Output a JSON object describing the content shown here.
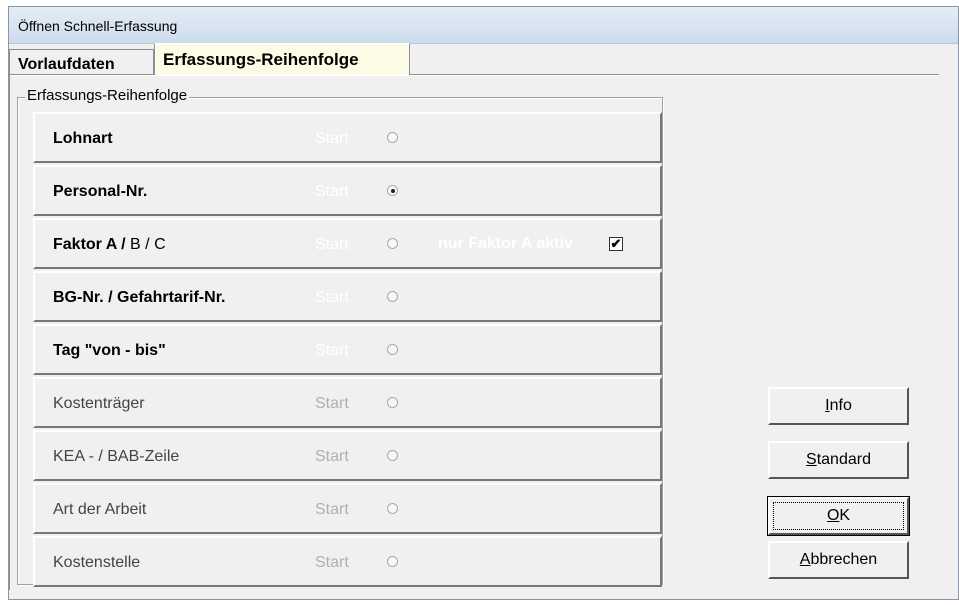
{
  "window": {
    "title": "Öffnen Schnell-Erfassung"
  },
  "tabs": [
    {
      "label": "Vorlaufdaten"
    },
    {
      "label": "Erfassungs-Reihenfolge"
    }
  ],
  "group": {
    "legend": "Erfassungs-Reihenfolge"
  },
  "rows": [
    {
      "label": "Lohnart",
      "start": "Start",
      "selected": false
    },
    {
      "label": "Personal-Nr.",
      "start": "Start",
      "selected": true
    },
    {
      "label_bold": "Faktor A /",
      "label_thin": " B / C",
      "start": "Start",
      "selected": false,
      "extra": "nur Faktor A aktiv",
      "extra_checked": true,
      "check_mark": "✔"
    },
    {
      "label": "BG-Nr. / Gefahrtarif-Nr.",
      "start": "Start",
      "selected": false
    },
    {
      "label": "Tag  \"von - bis\"",
      "start": "Start",
      "selected": false
    },
    {
      "label": "Kostenträger",
      "start": "Start",
      "selected": false
    },
    {
      "label": "KEA - / BAB-Zeile",
      "start": "Start",
      "selected": false
    },
    {
      "label": "Art der Arbeit",
      "start": "Start",
      "selected": false
    },
    {
      "label": "Kostenstelle",
      "start": "Start",
      "selected": false
    }
  ],
  "buttons": {
    "info": {
      "mnemonic": "I",
      "rest": "nfo"
    },
    "standard": {
      "mnemonic": "S",
      "rest": "tandard"
    },
    "ok": {
      "mnemonic": "O",
      "rest": "K"
    },
    "cancel": {
      "mnemonic": "A",
      "rest": "bbrechen"
    }
  }
}
